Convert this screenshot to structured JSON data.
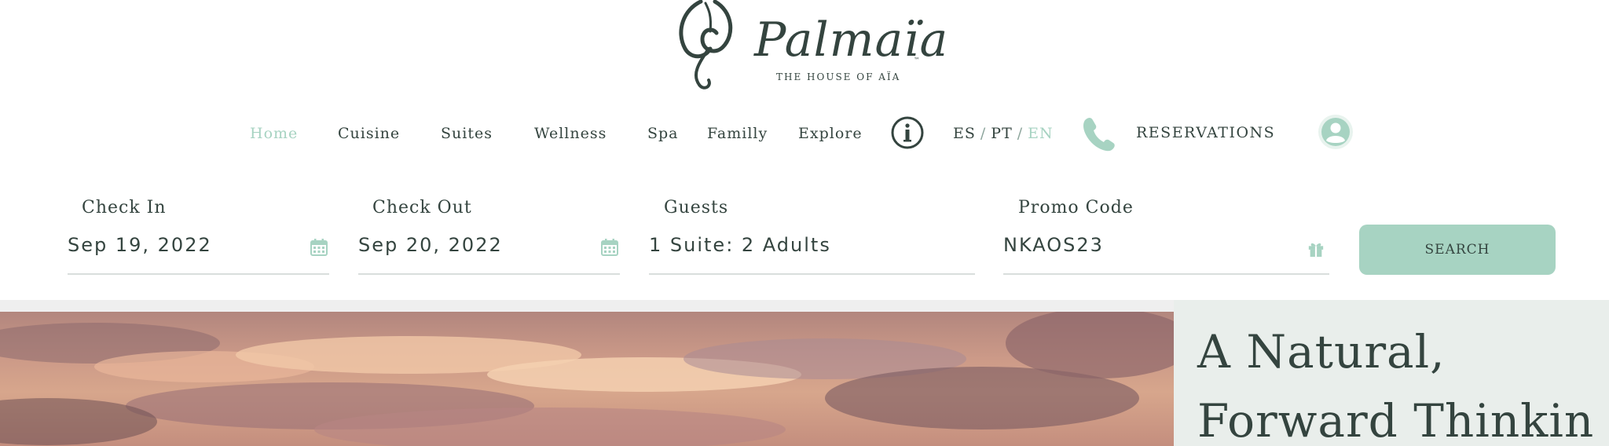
{
  "brand": {
    "name": "Palmaïa",
    "tagline": "THE HOUSE OF AÏA",
    "trademark": "™",
    "colors": {
      "accent": "#a7d3c2",
      "text": "#34443f",
      "panel": "#e9eeeb"
    }
  },
  "nav": {
    "items": [
      {
        "label": "Home",
        "active": true
      },
      {
        "label": "Cuisine"
      },
      {
        "label": "Suites"
      },
      {
        "label": "Wellness"
      },
      {
        "label": "Spa"
      },
      {
        "label": "Familly"
      },
      {
        "label": "Explore"
      }
    ],
    "info_icon": "info-circle-icon",
    "languages": [
      {
        "label": "ES"
      },
      {
        "label": "PT"
      },
      {
        "label": "EN",
        "active": true
      }
    ],
    "lang_separator": "/",
    "phone_icon": "phone-icon",
    "reservations_label": "RESERVATIONS",
    "account_icon": "user-avatar-icon"
  },
  "booking": {
    "check_in": {
      "label": "Check In",
      "value": "Sep 19, 2022",
      "icon": "calendar-icon"
    },
    "check_out": {
      "label": "Check Out",
      "value": "Sep 20, 2022",
      "icon": "calendar-icon"
    },
    "guests": {
      "label": "Guests",
      "value": "1 Suite: 2 Adults"
    },
    "promo": {
      "label": "Promo Code",
      "value": "NKAOS23",
      "icon": "gift-icon"
    },
    "search_label": "SEARCH"
  },
  "hero": {
    "title_line1": "A Natural,",
    "title_line2": "Forward Thinkin"
  }
}
